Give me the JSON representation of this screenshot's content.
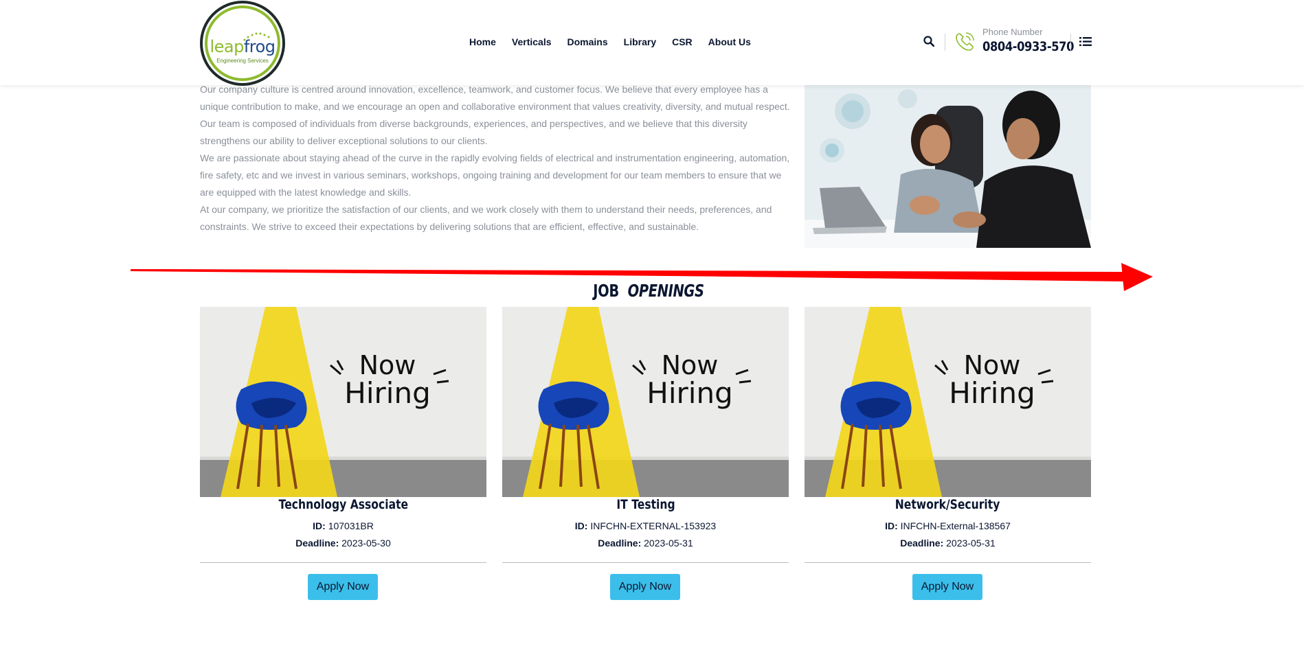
{
  "header": {
    "logo": {
      "name_part1": "leap",
      "name_part2": "frog",
      "subtitle": "Engineering Services"
    },
    "nav": [
      {
        "label": "Home"
      },
      {
        "label": "Verticals"
      },
      {
        "label": "Domains"
      },
      {
        "label": "Library"
      },
      {
        "label": "CSR"
      },
      {
        "label": "About Us"
      }
    ],
    "phone_label": "Phone Number",
    "phone_number": "0804-0933-570",
    "icons": [
      "search-icon",
      "phone-icon",
      "menu-list-icon"
    ]
  },
  "about": {
    "paragraphs": [
      "Our company culture is centred around innovation, excellence, teamwork, and customer focus. We believe that every employee has a unique contribution to make, and we encourage an open and collaborative environment that values creativity, diversity, and mutual respect.",
      "Our team is composed of individuals from diverse backgrounds, experiences, and perspectives, and we believe that this diversity strengthens our ability to deliver exceptional solutions to our clients.",
      "We are passionate about staying ahead of the curve in the rapidly evolving fields of electrical and instrumentation engineering, automation, fire safety, etc and we invest in various seminars, workshops, ongoing training and development for our team members to ensure that we are equipped with the latest knowledge and skills.",
      "At our company, we prioritize the satisfaction of our clients, and we work closely with them to understand their needs, preferences, and constraints. We strive to exceed their expectations by delivering solutions that are efficient, effective, and sustainable."
    ]
  },
  "section_title": {
    "part1": "JOB",
    "part2": "OPENINGS"
  },
  "jobs": [
    {
      "image_text": {
        "line1": "Now",
        "line2": "Hiring"
      },
      "title": "Technology Associate",
      "id_label": "ID:",
      "id_value": "107031BR",
      "deadline_label": "Deadline:",
      "deadline_value": "2023-05-30",
      "apply_label": "Apply Now"
    },
    {
      "image_text": {
        "line1": "Now",
        "line2": "Hiring"
      },
      "title": "IT Testing",
      "id_label": "ID:",
      "id_value": "INFCHN-EXTERNAL-153923",
      "deadline_label": "Deadline:",
      "deadline_value": "2023-05-31",
      "apply_label": "Apply Now"
    },
    {
      "image_text": {
        "line1": "Now",
        "line2": "Hiring"
      },
      "title": "Network/Security",
      "id_label": "ID:",
      "id_value": "INFCHN-External-138567",
      "deadline_label": "Deadline:",
      "deadline_value": "2023-05-31",
      "apply_label": "Apply Now"
    }
  ],
  "colors": {
    "navy": "#0b1630",
    "muted_text": "#8a8f98",
    "brand_green": "#8dbb2e",
    "apply_button": "#3bbfea",
    "annotation_arrow": "#ff0000",
    "spotlight_yellow": "#f2d61a",
    "chair_blue": "#1646b8"
  }
}
